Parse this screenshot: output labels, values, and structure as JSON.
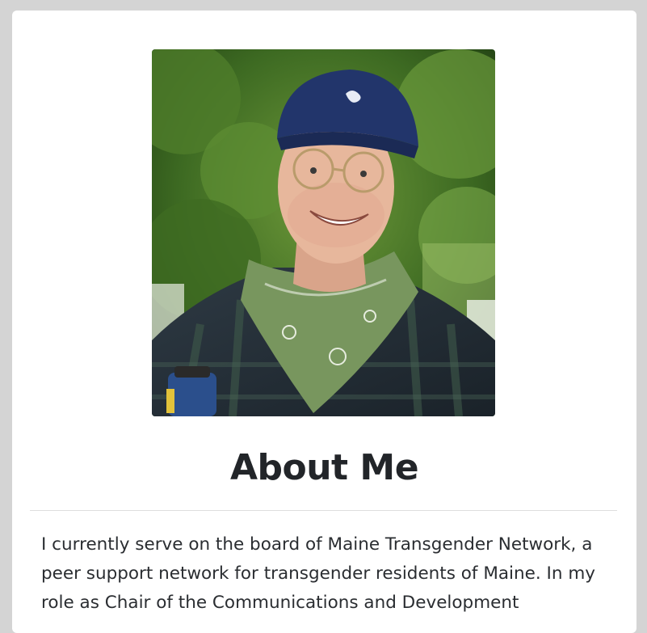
{
  "profile": {
    "photo_alt": "Portrait photo"
  },
  "about": {
    "title": "About Me",
    "bio": "I currently serve on the board of Maine Transgender Network, a peer support network for transgender residents of Maine. In my role as Chair of the Communications and Development"
  }
}
